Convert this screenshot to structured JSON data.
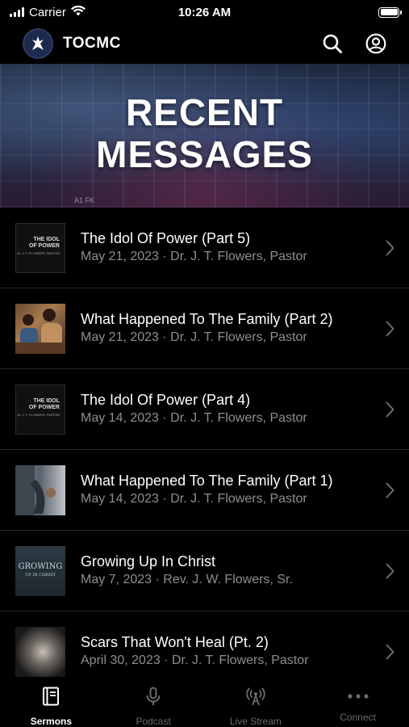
{
  "status_bar": {
    "carrier": "Carrier",
    "time": "10:26 AM"
  },
  "header": {
    "title": "TOCMC",
    "icons": [
      "search-icon",
      "account-icon"
    ]
  },
  "banner": {
    "line1": "RECENT",
    "line2": "MESSAGES",
    "small_text": "A1 FK"
  },
  "sermons": [
    {
      "title": "The Idol Of Power (Part 5)",
      "meta": "May 21, 2023 · Dr. J. T. Flowers, Pastor",
      "thumb_type": "idol",
      "thumb_line1": "THE IDOL",
      "thumb_line2": "OF POWER",
      "thumb_sub": "Dr. J. T. FLOWERS, PASTOR"
    },
    {
      "title": "What Happened To The Family (Part 2)",
      "meta": "May 21, 2023 · Dr. J. T. Flowers, Pastor",
      "thumb_type": "family-photo"
    },
    {
      "title": "The Idol Of Power (Part 4)",
      "meta": "May 14, 2023 · Dr. J. T. Flowers, Pastor",
      "thumb_type": "idol",
      "thumb_line1": "THE IDOL",
      "thumb_line2": "OF POWER",
      "thumb_sub": "Dr. J. T. FLOWERS, PASTOR"
    },
    {
      "title": "What Happened To The Family (Part 1)",
      "meta": "May 14, 2023 · Dr. J. T. Flowers, Pastor",
      "thumb_type": "family-photo"
    },
    {
      "title": "Growing Up In Christ",
      "meta": "May 7, 2023 · Rev. J. W. Flowers, Sr.",
      "thumb_type": "growing",
      "thumb_line1": "GROWING",
      "thumb_sub": "UP IN CHRIST"
    },
    {
      "title": "Scars That Won't Heal (Pt. 2)",
      "meta": "April 30, 2023 · Dr. J. T. Flowers, Pastor",
      "thumb_type": "hand-photo"
    }
  ],
  "tabs": [
    {
      "label": "Sermons",
      "icon": "book-icon",
      "active": true
    },
    {
      "label": "Podcast",
      "icon": "microphone-icon",
      "active": false
    },
    {
      "label": "Live Stream",
      "icon": "broadcast-icon",
      "active": false
    },
    {
      "label": "Connect",
      "icon": "more-dots-icon",
      "active": false
    }
  ],
  "colors": {
    "background": "#000000",
    "text": "#ffffff",
    "meta_text": "#8e8e8e",
    "inactive_tab": "#6c6c6c",
    "divider": "#262626"
  }
}
